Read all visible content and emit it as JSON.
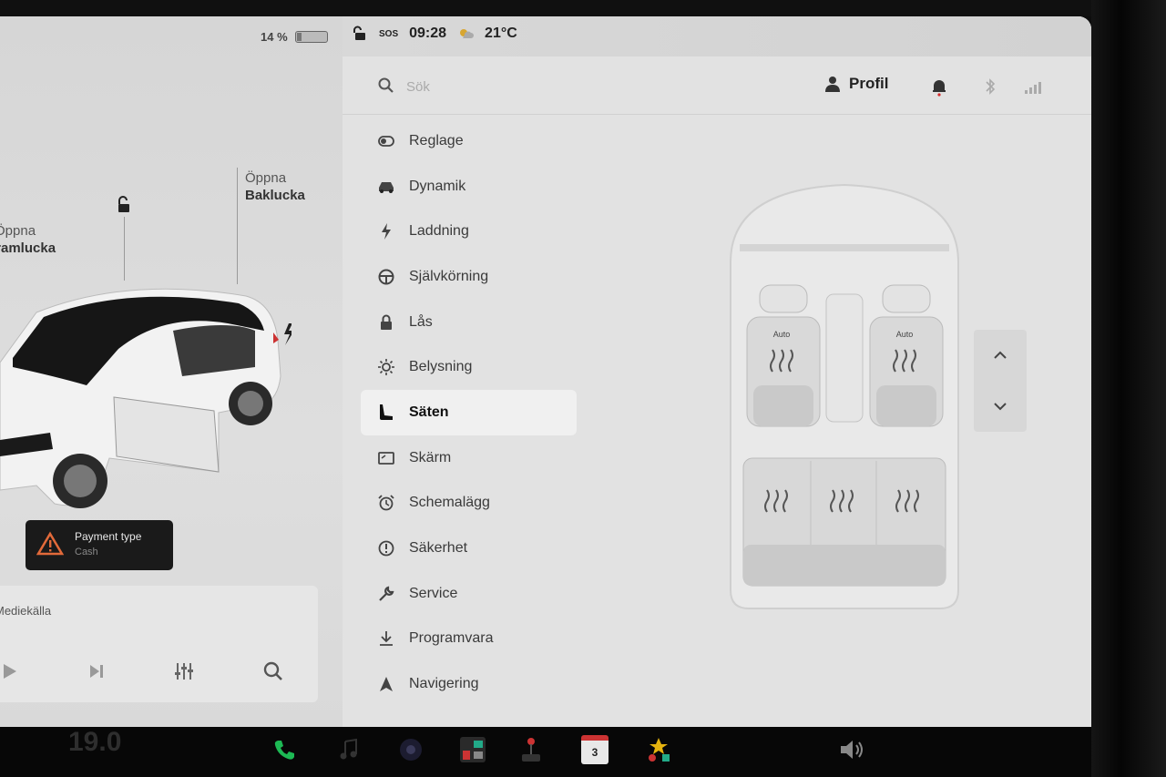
{
  "status": {
    "battery_percent": "14 %",
    "time": "09:28",
    "temperature": "21°C",
    "sos": "SOS"
  },
  "left": {
    "frunk_label_1": "Öppna",
    "frunk_label_2": "Framlucka",
    "trunk_label_1": "Öppna",
    "trunk_label_2": "Baklucka",
    "payment_title": "Payment type",
    "payment_sub": "Cash",
    "media_source": "Mediekälla"
  },
  "search": {
    "placeholder": "Sök"
  },
  "profile": {
    "label": "Profil"
  },
  "menu": {
    "items": [
      {
        "label": "Reglage",
        "icon": "toggle-icon"
      },
      {
        "label": "Dynamik",
        "icon": "car-icon"
      },
      {
        "label": "Laddning",
        "icon": "bolt-icon"
      },
      {
        "label": "Självkörning",
        "icon": "steering-wheel-icon"
      },
      {
        "label": "Lås",
        "icon": "lock-icon"
      },
      {
        "label": "Belysning",
        "icon": "light-icon"
      },
      {
        "label": "Säten",
        "icon": "seat-icon"
      },
      {
        "label": "Skärm",
        "icon": "display-icon"
      },
      {
        "label": "Schemalägg",
        "icon": "alarm-clock-icon"
      },
      {
        "label": "Säkerhet",
        "icon": "info-circle-icon"
      },
      {
        "label": "Service",
        "icon": "wrench-icon"
      },
      {
        "label": "Programvara",
        "icon": "download-icon"
      },
      {
        "label": "Navigering",
        "icon": "navigation-arrow-icon"
      }
    ],
    "active": "Säten"
  },
  "seats": {
    "front_left_mode": "Auto",
    "front_right_mode": "Auto"
  },
  "taskbar": {
    "cabin_temp": "19.0",
    "calendar_day": "3"
  },
  "colors": {
    "accent_red": "#d42b2b",
    "active_item_bg": "#f0f0f0",
    "phone_green": "#1db954"
  }
}
